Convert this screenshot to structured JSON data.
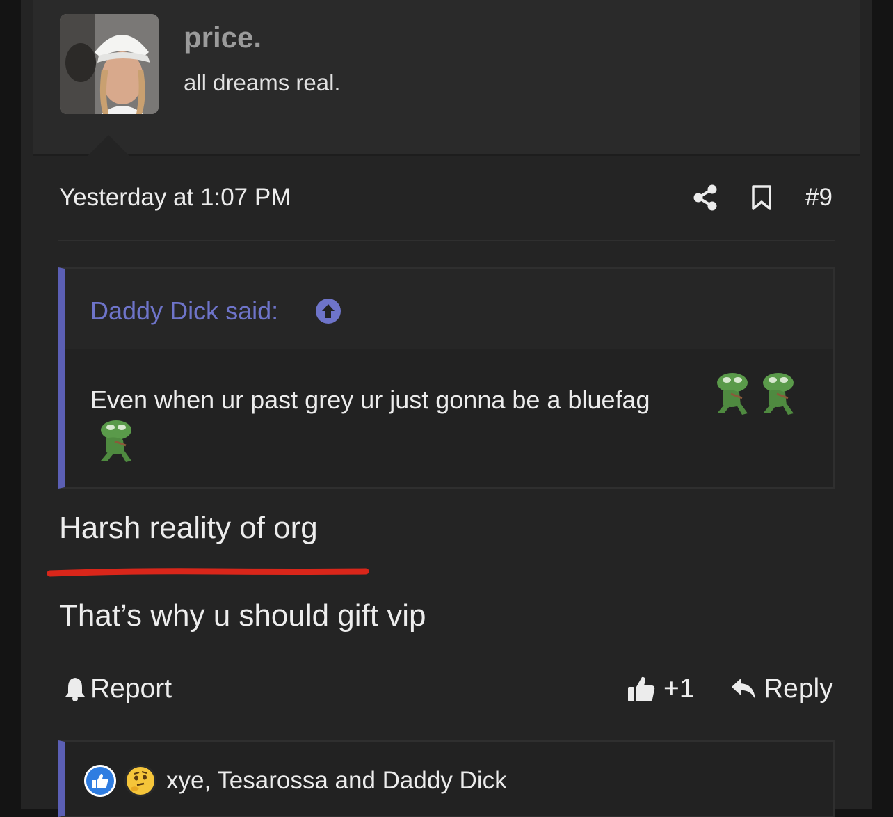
{
  "author": {
    "username": "price.",
    "title": "all dreams real.",
    "avatar_icon": "avatar-photo"
  },
  "post": {
    "date": "Yesterday at 1:07 PM",
    "number": "#9",
    "share_icon": "share-icon",
    "bookmark_icon": "bookmark-icon"
  },
  "quote": {
    "author_label": "Daddy Dick said:",
    "text": "Even when ur past grey ur just gonna be a bluefag",
    "emojis": [
      "crying-frog-emoji",
      "crying-frog-emoji",
      "crying-frog-emoji"
    ]
  },
  "body": {
    "line1": "Harsh reality of org",
    "line2": "That’s why u should gift vip",
    "underline_color": "#d9261a"
  },
  "actions": {
    "report": "Report",
    "like": "+1",
    "reply": "Reply"
  },
  "reactions": {
    "icons": [
      "like-reaction-icon",
      "thinking-reaction-icon"
    ],
    "text": "xye, Tesarossa and Daddy Dick"
  },
  "colors": {
    "accent": "#5b5fb4",
    "quote_author": "#6e74c9",
    "background": "#242424"
  }
}
